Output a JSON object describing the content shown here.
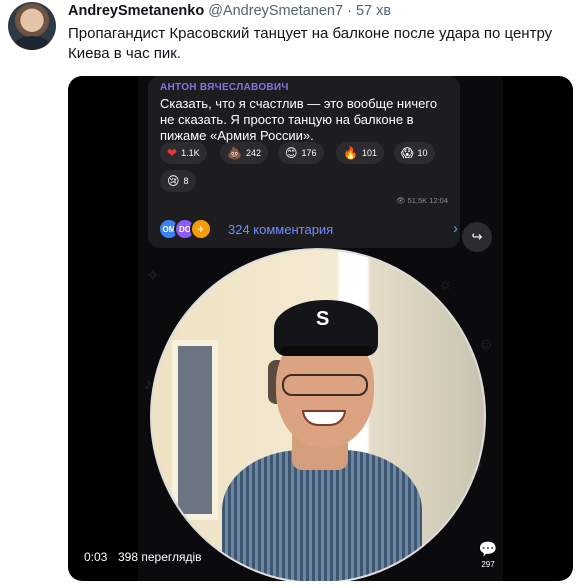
{
  "tweet": {
    "display_name": "AndreySmetanenko",
    "handle": "@AndreySmetanen7",
    "separator": "·",
    "time": "57 хв",
    "text": "Пропагандист Красовский танцует на балконе после удара по центру Киева в час пик."
  },
  "telegram_card": {
    "author": "АНТОН ВЯЧЕСЛАВОВИЧ",
    "message": "Сказать, что я счастлив — это вообще ничего не сказать. Я просто танцую на балконе в пижаме «Армия России».",
    "reactions": [
      {
        "icon": "heart",
        "glyph": "❤",
        "count": "1.1K"
      },
      {
        "icon": "poop",
        "glyph": "💩",
        "count": "242"
      },
      {
        "icon": "blush-face",
        "glyph": "😊",
        "count": "176"
      },
      {
        "icon": "fire",
        "glyph": "🔥",
        "count": "101"
      },
      {
        "icon": "scream-face",
        "glyph": "😱",
        "count": "10"
      },
      {
        "icon": "sad-face",
        "glyph": "😢",
        "count": "8"
      }
    ],
    "views_time": "👁 51,5K 12:04",
    "commenter_bubbles": [
      {
        "label": "OM",
        "color": "#3b82f6"
      },
      {
        "label": "DO",
        "color": "#8b5cf6"
      },
      {
        "label": "✈",
        "color": "#f59e0b"
      }
    ],
    "comments_label": "324 комментария",
    "chevron": "›",
    "share_glyph": "↪"
  },
  "video": {
    "elapsed": "0:03",
    "views": "398 переглядів",
    "side_glyph": "💬",
    "side_count": "297"
  }
}
